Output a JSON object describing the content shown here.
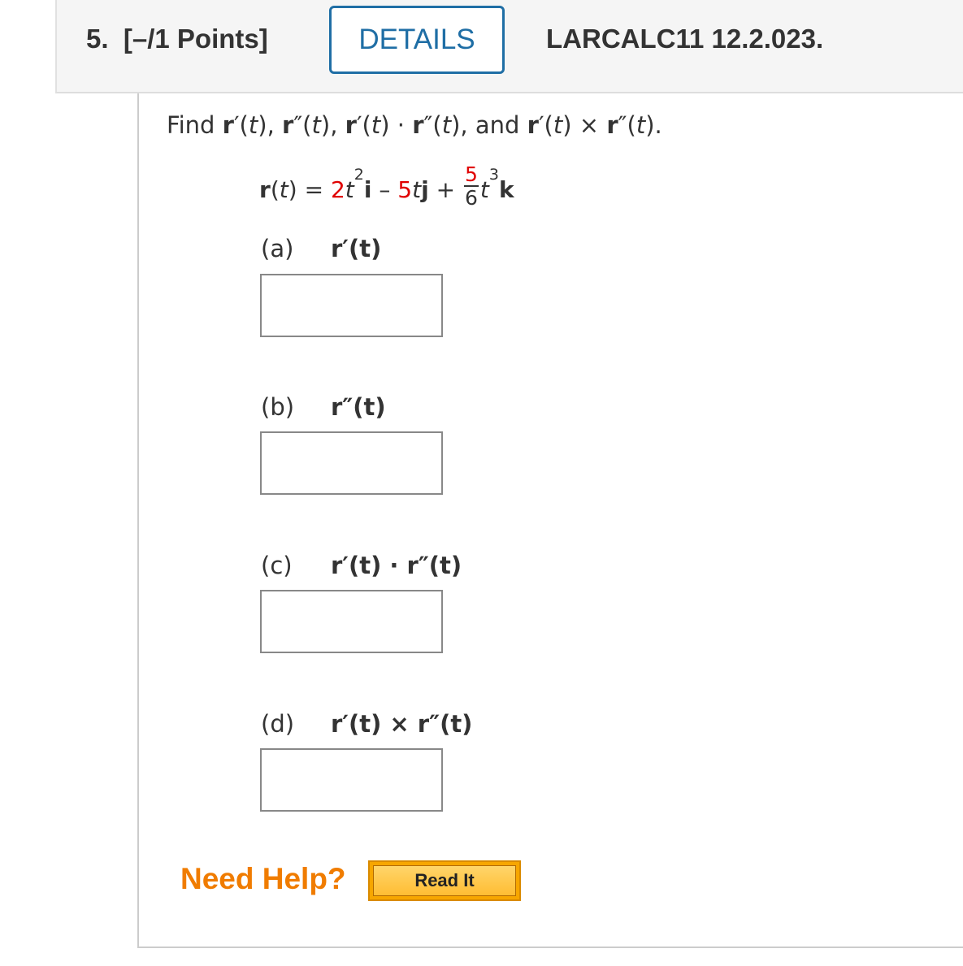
{
  "header": {
    "question_number": "5.",
    "points": "[–/1 Points]",
    "details_label": "DETAILS",
    "reference": "LARCALC11 12.2.023."
  },
  "prompt": {
    "find": "Find",
    "r": "r",
    "prime": "′",
    "dprime": "″",
    "t": "t",
    "open": "(",
    "close": ")",
    "comma": ",",
    "and": "and",
    "dot": "·",
    "cross": "×",
    "period": "."
  },
  "equation": {
    "lhs_r": "r",
    "lhs_t": "t",
    "equals": "=",
    "coef1": "2",
    "var1": "t",
    "exp1": "2",
    "i": "i",
    "minus": "–",
    "coef2": "5",
    "var2": "t",
    "j": "j",
    "plus": "+",
    "frac_num": "5",
    "frac_den": "6",
    "var3": "t",
    "exp3": "3",
    "k": "k"
  },
  "parts": [
    {
      "tag": "(a)",
      "expr": "r′(t)",
      "answer": ""
    },
    {
      "tag": "(b)",
      "expr": "r″(t)",
      "answer": ""
    },
    {
      "tag": "(c)",
      "expr": "r′(t) · r″(t)",
      "answer": ""
    },
    {
      "tag": "(d)",
      "expr": "r′(t) × r″(t)",
      "answer": ""
    }
  ],
  "help": {
    "label": "Need Help?",
    "read_it": "Read It"
  },
  "colors": {
    "accent": "#1f6ea5",
    "highlight": "#e00000",
    "help": "#f07c00",
    "button": "#f7a600"
  }
}
